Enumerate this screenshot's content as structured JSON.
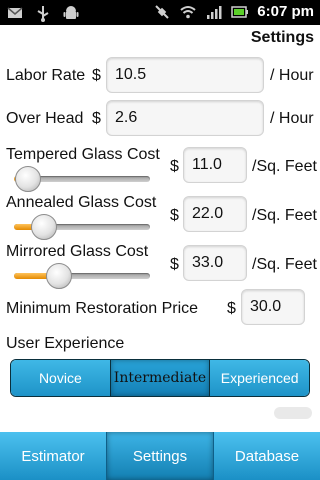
{
  "status": {
    "time": "6:07 pm",
    "icons": [
      "usb-icon",
      "mail-icon",
      "android-icon",
      "satellite-icon",
      "wifi-icon",
      "signal-icon",
      "battery-icon"
    ]
  },
  "page_title": "Settings",
  "labor_rate": {
    "label": "Labor Rate",
    "currency": "$",
    "value": "10.5",
    "unit": "/ Hour"
  },
  "overhead": {
    "label": "Over Head",
    "currency": "$",
    "value": "2.6",
    "unit": "/ Hour"
  },
  "tempered": {
    "label": "Tempered Glass Cost",
    "currency": "$",
    "value": "11.0",
    "unit": "/Sq. Feet",
    "slider_fraction": 0.1
  },
  "annealed": {
    "label": "Annealed Glass Cost",
    "currency": "$",
    "value": "22.0",
    "unit": "/Sq. Feet",
    "slider_fraction": 0.22
  },
  "mirrored": {
    "label": "Mirrored Glass Cost",
    "currency": "$",
    "value": "33.0",
    "unit": "/Sq. Feet",
    "slider_fraction": 0.33
  },
  "min_restoration": {
    "label": "Minimum Restoration Price",
    "currency": "$",
    "value": "30.0"
  },
  "user_experience": {
    "label": "User Experience",
    "options": [
      "Novice",
      "Intermediate",
      "Experienced"
    ],
    "selected": "Intermediate"
  },
  "tabs": [
    {
      "label": "Estimator"
    },
    {
      "label": "Settings",
      "active": true
    },
    {
      "label": "Database"
    }
  ],
  "colors": {
    "accent_blue": "#1e93c8",
    "slider_orange": "#e48a00"
  }
}
